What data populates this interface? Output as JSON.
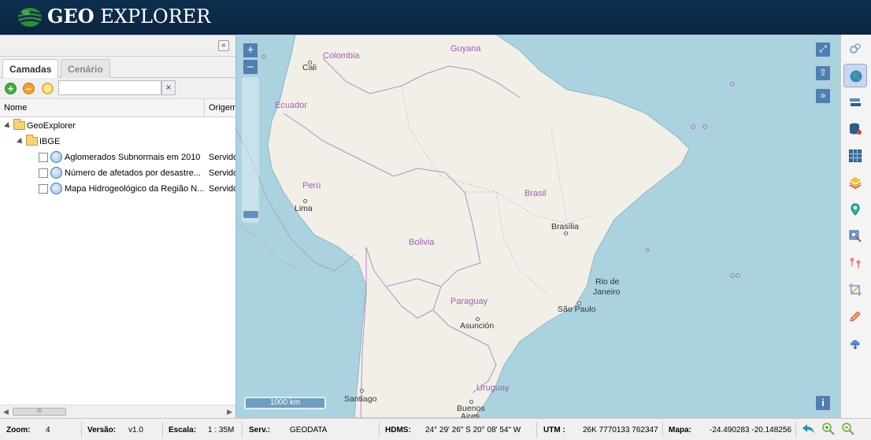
{
  "header": {
    "logo_geo": "GEO",
    "logo_explorer": " EXPLORER"
  },
  "panel": {
    "collapse_glyph": "«",
    "tabs": [
      {
        "label": "Camadas"
      },
      {
        "label": "Cenário"
      }
    ],
    "search": {
      "value": "",
      "placeholder": ""
    },
    "clear_glyph": "×",
    "columns": {
      "name": "Nome",
      "origin": "Origem"
    },
    "tree": {
      "root": "GeoExplorer",
      "group": "IBGE",
      "layers": [
        {
          "label": "Aglomerados Subnormais em 2010",
          "origin": "Servidor"
        },
        {
          "label": "Número de afetados por desastre...",
          "origin": "Servidor"
        },
        {
          "label": "Mapa Hidrogeológico da Região N...",
          "origin": "Servidor"
        }
      ]
    },
    "scroll_thumb": "III"
  },
  "map": {
    "zoom_in": "+",
    "zoom_out": "–",
    "scale": "1000 km",
    "info": "i",
    "countries": [
      "Colombia",
      "Guyana",
      "Ecuador",
      "Perú",
      "Brasil",
      "Bolivia",
      "Paraguay",
      "Uruguay"
    ],
    "cities": [
      "Cali",
      "Lima",
      "Brasília",
      "Rio de",
      "Janeiro",
      "São Paulo",
      "Asunción",
      "Santiago",
      "Buenos",
      "Aires"
    ]
  },
  "right_toolbar": {
    "icons": [
      "settings-gears-icon",
      "globe-icon",
      "layer-swap-icon",
      "database-icon",
      "grid-icon",
      "layers-stack-icon",
      "map-pin-icon",
      "search-location-icon",
      "route-points-icon",
      "crop-icon",
      "pencil-icon",
      "cloud-download-icon"
    ],
    "active": "globe-icon"
  },
  "status": {
    "zoom_label": "Zoom:",
    "zoom_value": "4",
    "version_label": "Versão:",
    "version_value": "v1.0",
    "scale_label": "Escala:",
    "scale_value": "1 : 35M",
    "serv_label": "Serv.:",
    "serv_value": "GEODATA",
    "hdms_label": "HDMS:",
    "hdms_value": "24° 29' 26\" S 20° 08' 54\" W",
    "utm_label": "UTM :",
    "utm_value": "26K 7770133 762347",
    "map_label": "Mapa:",
    "map_value": "-24.490283 -20.148256"
  },
  "colors": {
    "header": "#0f2f4f",
    "ocean": "#aad3df",
    "land": "#f2efe9",
    "border": "#b48ec0"
  }
}
